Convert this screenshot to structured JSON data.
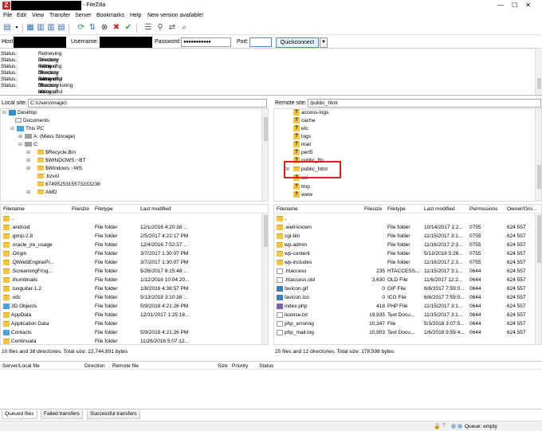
{
  "window": {
    "title_suffix": "- FileZilla",
    "app_icon": "Z"
  },
  "menu": [
    "File",
    "Edit",
    "View",
    "Transfer",
    "Server",
    "Bookmarks",
    "Help",
    "New version available!"
  ],
  "quickconnect": {
    "host_label": "Host:",
    "username_label": "Username:",
    "password_label": "Password:",
    "password_value": "●●●●●●●●●●●",
    "port_label": "Port:",
    "port_value": "",
    "button": "Quickconnect",
    "dropdown": "▼"
  },
  "log": [
    {
      "tag": "Status:",
      "msg": "Retrieving directory listing..."
    },
    {
      "tag": "Status:",
      "msg": "Directory listing of \"/\" successful"
    },
    {
      "tag": "Status:",
      "msg": "Retrieving directory listing of \"/\"..."
    },
    {
      "tag": "Status:",
      "msg": "Directory listing of \"/\" successful"
    },
    {
      "tag": "Status:",
      "msg": "Retrieving directory listing of \"/public_html\"..."
    },
    {
      "tag": "Status:",
      "msg": "Directory listing of \"/public_html\" successful"
    }
  ],
  "local": {
    "site_label": "Local site:",
    "path": "C:\\Users\\magic\\",
    "tree": [
      {
        "label": "Desktop",
        "type": "desktop",
        "indent": 0,
        "exp": "⊟"
      },
      {
        "label": "Documents",
        "type": "doc",
        "indent": 1,
        "exp": ""
      },
      {
        "label": "This PC",
        "type": "pc",
        "indent": 1,
        "exp": "⊟"
      },
      {
        "label": "A: (Mass Storage)",
        "type": "drive",
        "indent": 2,
        "exp": "⊞"
      },
      {
        "label": "C:",
        "type": "drive",
        "indent": 2,
        "exp": "⊟"
      },
      {
        "label": "$Recycle.Bin",
        "type": "folder",
        "indent": 3,
        "exp": "⊞"
      },
      {
        "label": "$WINDOWS.~BT",
        "type": "folder",
        "indent": 3,
        "exp": "⊞"
      },
      {
        "label": "$Windows.~WS",
        "type": "folder",
        "indent": 3,
        "exp": "⊞"
      },
      {
        "label": ".bzvol",
        "type": "folder",
        "indent": 3,
        "exp": ""
      },
      {
        "label": "6749525315573233238",
        "type": "folder",
        "indent": 3,
        "exp": ""
      },
      {
        "label": "AMD",
        "type": "folder",
        "indent": 3,
        "exp": "⊞"
      }
    ],
    "columns": [
      "Filename",
      "Filesize",
      "Filetype",
      "Last modified"
    ],
    "files": [
      {
        "name": "..",
        "size": "",
        "type": "",
        "modified": "",
        "icon": "folder"
      },
      {
        "name": ".android",
        "size": "",
        "type": "File folder",
        "modified": "12/1/2016 4:20:38 ...",
        "icon": "folder"
      },
      {
        "name": ".gimp-2.8",
        "size": "",
        "type": "File folder",
        "modified": "2/5/2017 4:22:17 PM",
        "icon": "folder"
      },
      {
        "name": ".oracle_jre_usage",
        "size": "",
        "type": "File folder",
        "modified": "12/4/2016 7:52:37 ...",
        "icon": "folder"
      },
      {
        "name": ".Origin",
        "size": "",
        "type": "File folder",
        "modified": "3/7/2017 1:30:07 PM",
        "icon": "folder"
      },
      {
        "name": ".QtWebEnginePr...",
        "size": "",
        "type": "File folder",
        "modified": "3/7/2017 1:30:07 PM",
        "icon": "folder"
      },
      {
        "name": ".ScreamingFrog...",
        "size": "",
        "type": "File folder",
        "modified": "5/26/2017 9:15:48 ...",
        "icon": "folder"
      },
      {
        "name": ".thumbnails",
        "size": "",
        "type": "File folder",
        "modified": "1/12/2016 10:04:20...",
        "icon": "folder"
      },
      {
        "name": ".tuxguitar-1.2",
        "size": "",
        "type": "File folder",
        "modified": "1/8/2016 4:38:57 PM",
        "icon": "folder"
      },
      {
        "name": ".vdc",
        "size": "",
        "type": "File folder",
        "modified": "5/13/2018 3:10:38 ...",
        "icon": "folder"
      },
      {
        "name": "3D Objects",
        "size": "",
        "type": "File folder",
        "modified": "5/9/2018 4:21:26 PM",
        "icon": "blue"
      },
      {
        "name": "AppData",
        "size": "",
        "type": "File folder",
        "modified": "12/31/2017 1:25:18...",
        "icon": "folder"
      },
      {
        "name": "Application Data",
        "size": "",
        "type": "File folder",
        "modified": "",
        "icon": "folder"
      },
      {
        "name": "Contacts",
        "size": "",
        "type": "File folder",
        "modified": "5/9/2018 4:21:26 PM",
        "icon": "blue"
      },
      {
        "name": "Continuata",
        "size": "",
        "type": "File folder",
        "modified": "11/26/2016 5:07:12...",
        "icon": "folder"
      }
    ],
    "status": "10 files and 38 directories. Total size: 22,744,891 bytes"
  },
  "remote": {
    "site_label": "Remote site:",
    "path": "/public_html",
    "tree": [
      {
        "label": "access-logs",
        "type": "q"
      },
      {
        "label": "cache",
        "type": "q"
      },
      {
        "label": "etc",
        "type": "q"
      },
      {
        "label": "logs",
        "type": "q"
      },
      {
        "label": "mail",
        "type": "q"
      },
      {
        "label": "perl5",
        "type": "q"
      },
      {
        "label": "public_ftp",
        "type": "q"
      },
      {
        "label": "public_html",
        "type": "folder"
      },
      {
        "label": "ssl",
        "type": "q"
      },
      {
        "label": "tmp",
        "type": "q"
      },
      {
        "label": "www",
        "type": "q"
      }
    ],
    "columns": [
      "Filename",
      "Filesize",
      "Filetype",
      "Last modified",
      "Permissions",
      "Owner/Gro..."
    ],
    "files": [
      {
        "name": "..",
        "size": "",
        "type": "",
        "modified": "",
        "perm": "",
        "owner": "",
        "icon": "folder"
      },
      {
        "name": ".well-known",
        "size": "",
        "type": "File folder",
        "modified": "10/14/2017 1:2...",
        "perm": "0755",
        "owner": "624 557",
        "icon": "folder"
      },
      {
        "name": "cgi-bin",
        "size": "",
        "type": "File folder",
        "modified": "11/15/2017 3:1...",
        "perm": "0755",
        "owner": "624 557",
        "icon": "folder"
      },
      {
        "name": "wp-admin",
        "size": "",
        "type": "File folder",
        "modified": "11/16/2017 2:3...",
        "perm": "0755",
        "owner": "624 557",
        "icon": "folder"
      },
      {
        "name": "wp-content",
        "size": "",
        "type": "File folder",
        "modified": "5/13/2018 5:28...",
        "perm": "0755",
        "owner": "624 557",
        "icon": "folder"
      },
      {
        "name": "wp-includes",
        "size": "",
        "type": "File folder",
        "modified": "11/16/2017 2:3...",
        "perm": "0755",
        "owner": "624 557",
        "icon": "folder"
      },
      {
        "name": ".htaccess",
        "size": "235",
        "type": "HTACCESS...",
        "modified": "11/15/2017 3:1...",
        "perm": "0644",
        "owner": "624 557",
        "icon": "file"
      },
      {
        "name": ".htaccess.old",
        "size": "3,630",
        "type": "OLD File",
        "modified": "11/6/2017 12:2...",
        "perm": "0644",
        "owner": "624 557",
        "icon": "file"
      },
      {
        "name": "favicon.gif",
        "size": "0",
        "type": "GIF File",
        "modified": "6/8/2017 7:59:0...",
        "perm": "0644",
        "owner": "624 557",
        "icon": "img"
      },
      {
        "name": "favicon.ico",
        "size": "0",
        "type": "ICO File",
        "modified": "6/8/2017 7:59:0...",
        "perm": "0644",
        "owner": "624 557",
        "icon": "img"
      },
      {
        "name": "index.php",
        "size": "418",
        "type": "PHP File",
        "modified": "11/15/2017 3:1...",
        "perm": "0644",
        "owner": "624 557",
        "icon": "php"
      },
      {
        "name": "license.txt",
        "size": "19,935",
        "type": "Text Docu...",
        "modified": "11/15/2017 3:1...",
        "perm": "0644",
        "owner": "624 557",
        "icon": "file"
      },
      {
        "name": "php_errorlog",
        "size": "10,347",
        "type": "File",
        "modified": "5/3/2018 3:07:5...",
        "perm": "0644",
        "owner": "624 557",
        "icon": "file"
      },
      {
        "name": "php_mail.log",
        "size": "10,903",
        "type": "Text Docu...",
        "modified": "1/6/2018 9:59:4...",
        "perm": "0644",
        "owner": "624 557",
        "icon": "file"
      }
    ],
    "status": "25 files and 12 directories. Total size: 178,598 bytes"
  },
  "queue": {
    "columns": [
      "Server/Local file",
      "Direction",
      "Remote file",
      "Size",
      "Priority",
      "Status"
    ]
  },
  "tabs": [
    "Queued files",
    "Failed transfers",
    "Successful transfers"
  ],
  "statusbar": {
    "queue": "Queue: empty"
  },
  "colors": {
    "highlight": "#e02020",
    "folder": "#f5c542",
    "accent": "#4a90d9"
  }
}
